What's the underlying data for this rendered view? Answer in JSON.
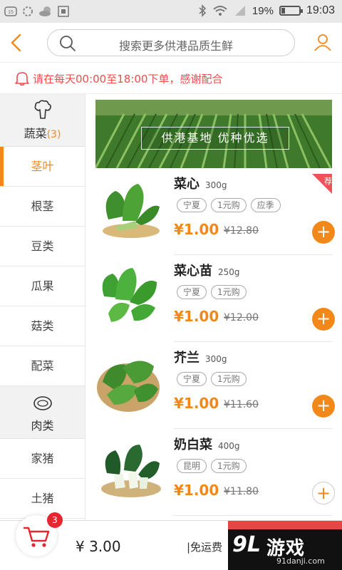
{
  "status_bar": {
    "battery": "19%",
    "time": "19:03",
    "battery_level": 0.19
  },
  "header": {
    "search_placeholder": "搜索更多供港品质生鲜"
  },
  "notice": {
    "text": "请在每天00:00至18:00下单，感谢配合"
  },
  "sidebar": {
    "groups": [
      {
        "label": "蔬菜",
        "count": "(3)",
        "icon": "broccoli-icon",
        "items": [
          "茎叶",
          "根茎",
          "豆类",
          "瓜果",
          "菇类",
          "配菜"
        ]
      },
      {
        "label": "肉类",
        "icon": "meat-icon",
        "items": [
          "家猪",
          "土猪"
        ]
      }
    ],
    "active_item": "茎叶"
  },
  "banner": {
    "text": "供港基地 优种优选"
  },
  "products": [
    {
      "name": "菜心",
      "weight": "300g",
      "tags": [
        "宁夏",
        "1元购",
        "应季"
      ],
      "price": "¥1.00",
      "original_price": "¥12.80",
      "badge": "荐",
      "add_style": "filled"
    },
    {
      "name": "菜心苗",
      "weight": "250g",
      "tags": [
        "宁夏",
        "1元购"
      ],
      "price": "¥1.00",
      "original_price": "¥12.00",
      "add_style": "filled"
    },
    {
      "name": "芥兰",
      "weight": "300g",
      "tags": [
        "宁夏",
        "1元购"
      ],
      "price": "¥1.00",
      "original_price": "¥11.60",
      "add_style": "filled"
    },
    {
      "name": "奶白菜",
      "weight": "400g",
      "tags": [
        "昆明",
        "1元购"
      ],
      "price": "¥1.00",
      "original_price": "¥11.80",
      "add_style": "outline"
    }
  ],
  "bottom_bar": {
    "cart_count": "3",
    "total": "¥ 3.00",
    "shipping": "|免运费"
  },
  "watermark": {
    "brand": "游戏",
    "mark": "9L",
    "url": "91danji.com"
  },
  "colors": {
    "accent": "#f3881a",
    "notice": "#f34b4b",
    "badge": "#e8262f"
  }
}
